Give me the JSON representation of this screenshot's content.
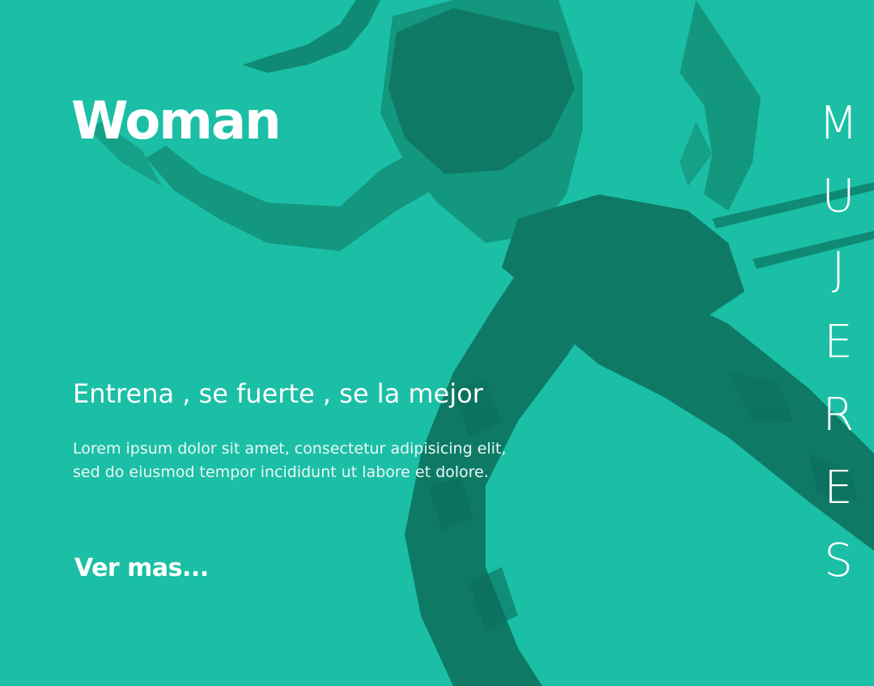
{
  "hero": {
    "title": "Woman",
    "subtitle": "Entrena , se fuerte , se la mejor",
    "body_lines": [
      "Lorem ipsum dolor sit amet, consectetur adipisicing elit,",
      "sed do eiusmod tempor incididunt ut labore et dolore."
    ],
    "link_label": "Ver mas...",
    "vertical_letters": [
      "M",
      "U",
      "J",
      "E",
      "R",
      "E",
      "S"
    ]
  },
  "colors": {
    "background": "#1bbfa6",
    "figure_skin": "#13977f",
    "figure_clothing": "#0e7a66",
    "text": "#ffffff"
  }
}
